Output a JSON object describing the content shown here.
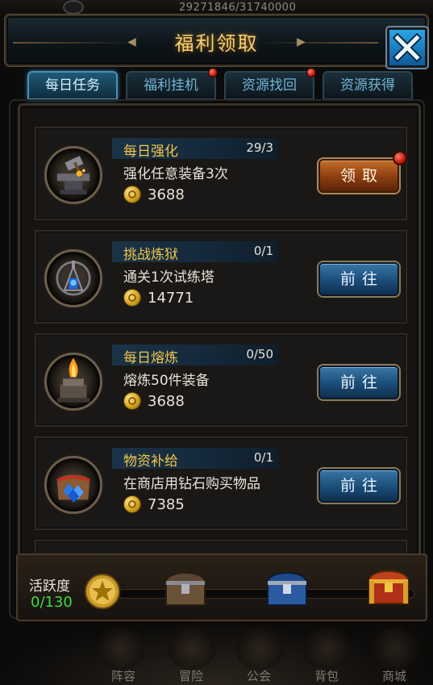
{
  "background": {
    "top_number": "29271846/31740000",
    "bottom_nav": [
      "阵容",
      "冒险",
      "公会",
      "背包",
      "商城"
    ]
  },
  "header": {
    "title": "福利领取",
    "close_icon": "close-icon",
    "accent": "#f3ce78"
  },
  "tabs": [
    {
      "label": "每日任务",
      "active": true,
      "badge": false
    },
    {
      "label": "福利挂机",
      "active": false,
      "badge": true
    },
    {
      "label": "资源找回",
      "active": false,
      "badge": true
    },
    {
      "label": "资源获得",
      "active": false,
      "badge": false
    }
  ],
  "tasks": [
    {
      "name": "每日强化",
      "progress": "29/3",
      "desc": "强化任意装备3次",
      "reward": "3688",
      "button": "领取",
      "button_type": "claim",
      "badge": true,
      "icon": "anvil-icon"
    },
    {
      "name": "挑战炼狱",
      "progress": "0/1",
      "desc": "通关1次试练塔",
      "reward": "14771",
      "button": "前往",
      "button_type": "go",
      "badge": false,
      "icon": "tower-icon"
    },
    {
      "name": "每日熔炼",
      "progress": "0/50",
      "desc": "熔炼50件装备",
      "reward": "3688",
      "button": "前往",
      "button_type": "go",
      "badge": false,
      "icon": "furnace-icon"
    },
    {
      "name": "物资补给",
      "progress": "0/1",
      "desc": "在商店用钻石购买物品",
      "reward": "7385",
      "button": "前往",
      "button_type": "go",
      "badge": false,
      "icon": "diamond-bag-icon"
    }
  ],
  "activity": {
    "label": "活跃度",
    "value": "0/130",
    "value_color": "#3ddc3d",
    "chests": [
      "wooden-chest-icon",
      "blue-chest-icon",
      "gold-chest-icon"
    ]
  }
}
